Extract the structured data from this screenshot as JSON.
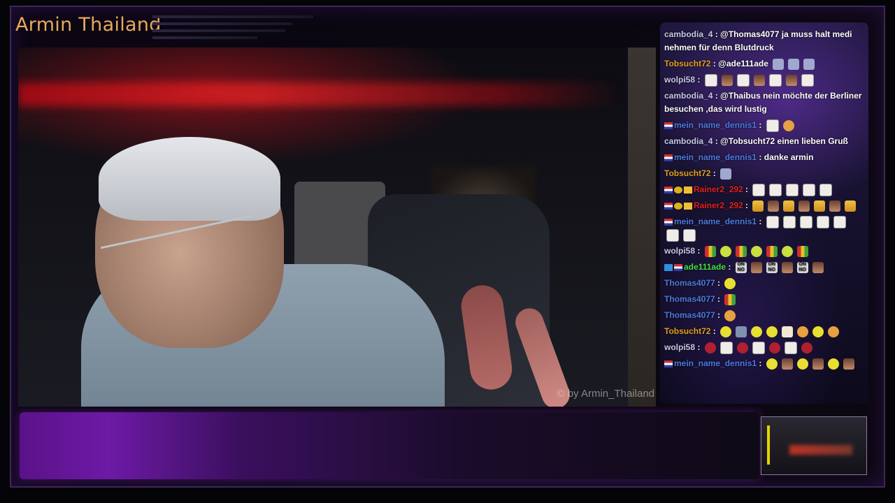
{
  "stream": {
    "title": "Armin Thailand",
    "watermark": "© by Armin_Thailand"
  },
  "colors": {
    "title": "#e8a95a",
    "accent_purple": "#6d1aa5"
  },
  "chat": {
    "messages": [
      {
        "user": "cambodia_4",
        "color": "#c8c8e8",
        "text": "@Thomas4077 ja muss halt medi nehmen für denn Blutdruck",
        "badges": [],
        "emotes": []
      },
      {
        "user": "Tobsucht72",
        "color": "#e0a020",
        "text": "@ade111ade",
        "badges": [],
        "emotes": [
          "shark",
          "shark",
          "shark"
        ]
      },
      {
        "user": "wolpi58",
        "color": "#c8c8e8",
        "text": "",
        "badges": [],
        "emotes": [
          "star",
          "face",
          "star",
          "face",
          "star",
          "face",
          "star"
        ]
      },
      {
        "user": "cambodia_4",
        "color": "#c8c8e8",
        "text": "@Thaibus nein möchte der Berliner besuchen ,das wird lustig",
        "badges": [],
        "emotes": []
      },
      {
        "user": "mein_name_dennis1",
        "color": "#4a7adf",
        "text": "",
        "badges": [
          "flag"
        ],
        "emotes": [
          "star",
          "cat"
        ]
      },
      {
        "user": "cambodia_4",
        "color": "#c8c8e8",
        "text": "@Tobsucht72 einen lieben Gruß",
        "badges": [],
        "emotes": []
      },
      {
        "user": "mein_name_dennis1",
        "color": "#4a7adf",
        "text": "danke armin",
        "badges": [
          "flag"
        ],
        "emotes": []
      },
      {
        "user": "Tobsucht72",
        "color": "#e0a020",
        "text": "",
        "badges": [],
        "emotes": [
          "shark"
        ]
      },
      {
        "user": "Rainer2_292",
        "color": "#e02020",
        "text": "",
        "badges": [
          "flag",
          "coin",
          "crown"
        ],
        "emotes": [
          "star",
          "star",
          "star",
          "star",
          "star"
        ]
      },
      {
        "user": "Rainer2_292",
        "color": "#e02020",
        "text": "",
        "badges": [
          "flag",
          "coin",
          "crown"
        ],
        "emotes": [
          "beer",
          "face",
          "beer",
          "face",
          "beer",
          "face",
          "beer"
        ]
      },
      {
        "user": "mein_name_dennis1",
        "color": "#4a7adf",
        "text": "",
        "badges": [
          "flag"
        ],
        "emotes": [
          "star",
          "star",
          "star",
          "star",
          "star",
          "star",
          "star"
        ]
      },
      {
        "user": "wolpi58",
        "color": "#c8c8e8",
        "text": "",
        "badges": [],
        "emotes": [
          "chart",
          "pog",
          "chart",
          "pog",
          "chart",
          "pog",
          "chart"
        ]
      },
      {
        "user": "ade111ade",
        "color": "#40e040",
        "text": "",
        "badges": [
          "sub",
          "flag"
        ],
        "emotes": [
          "nono",
          "face",
          "nono",
          "face",
          "nono",
          "face"
        ]
      },
      {
        "user": "Thomas4077",
        "color": "#4a7adf",
        "text": "",
        "badges": [],
        "emotes": [
          "blob"
        ]
      },
      {
        "user": "Thomas4077",
        "color": "#4a7adf",
        "text": "",
        "badges": [],
        "emotes": [
          "chart"
        ]
      },
      {
        "user": "Thomas4077",
        "color": "#4a7adf",
        "text": "",
        "badges": [],
        "emotes": [
          "cat"
        ]
      },
      {
        "user": "Tobsucht72",
        "color": "#e0a020",
        "text": "",
        "badges": [],
        "emotes": [
          "blob",
          "robot",
          "blob",
          "blob",
          "note",
          "cat",
          "blob",
          "cat"
        ]
      },
      {
        "user": "wolpi58",
        "color": "#c8c8e8",
        "text": "",
        "badges": [],
        "emotes": [
          "red",
          "star",
          "red",
          "star",
          "red",
          "star",
          "red"
        ]
      },
      {
        "user": "mein_name_dennis1",
        "color": "#4a7adf",
        "text": "",
        "badges": [
          "flag"
        ],
        "emotes": [
          "blob",
          "face",
          "blob",
          "face",
          "blob",
          "face"
        ]
      }
    ]
  }
}
